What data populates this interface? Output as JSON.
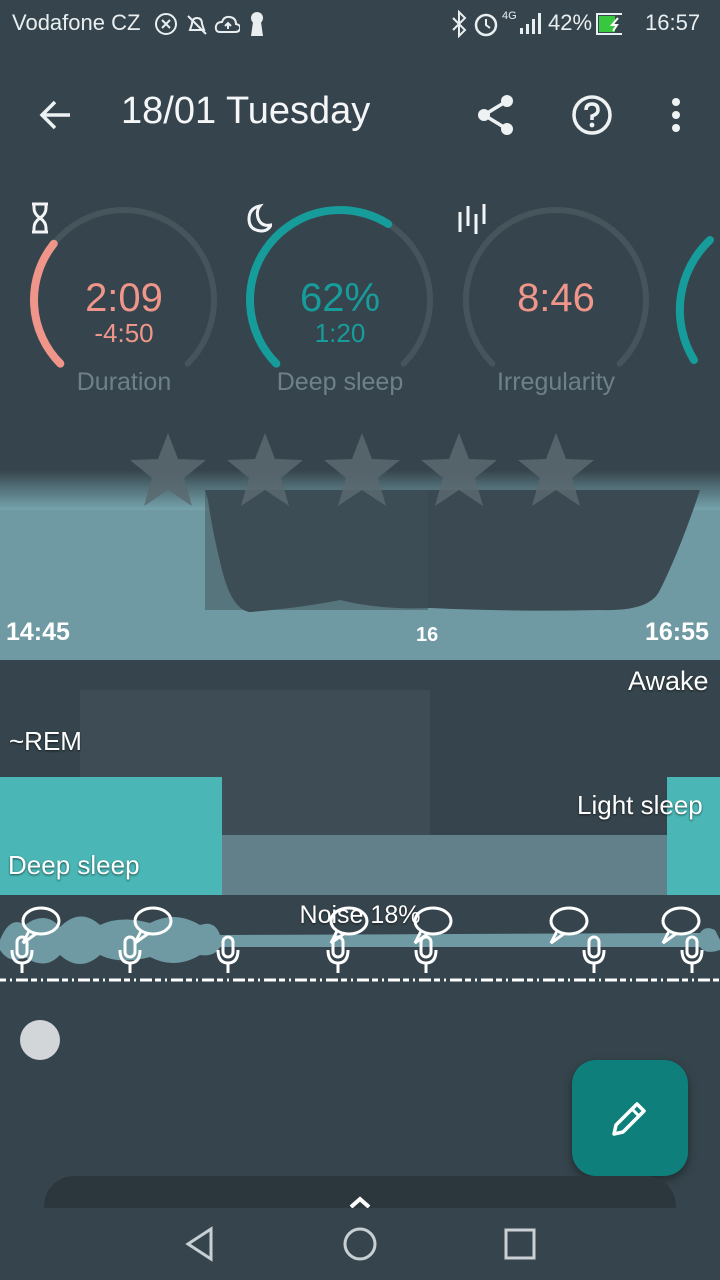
{
  "status_bar": {
    "carrier": "Vodafone CZ",
    "network": "4G",
    "battery": "42%",
    "time": "16:57",
    "icons": [
      "close-circle-icon",
      "alarm-off-icon",
      "cloud-upload-icon",
      "keyhole-icon",
      "bluetooth-icon",
      "alarm-icon",
      "signal-icon",
      "battery-charging-icon"
    ]
  },
  "app_bar": {
    "title": "18/01 Tuesday",
    "back_icon": "arrow-back-icon",
    "share_icon": "share-icon",
    "help_icon": "help-icon",
    "menu_icon": "more-vert-icon"
  },
  "gauges": [
    {
      "icon": "hourglass-icon",
      "value": "2:09",
      "sub": "-4:50",
      "label": "Duration",
      "color": "#f0958a",
      "fill": 0.31
    },
    {
      "icon": "moon-icon",
      "value": "62%",
      "sub": "1:20",
      "label": "Deep sleep",
      "color": "#169c9a",
      "fill": 0.62
    },
    {
      "icon": "irregularity-icon",
      "value": "8:46",
      "sub": "",
      "label": "Irregularity",
      "color": "#f0958a",
      "fill": 0.0
    }
  ],
  "rating": {
    "stars": 5,
    "filled": 0
  },
  "graph": {
    "start_time": "14:45",
    "mid_tick": "16",
    "end_time": "16:55"
  },
  "hypnogram": {
    "labels": {
      "awake": "Awake",
      "rem": "~REM",
      "light": "Light sleep",
      "deep": "Deep sleep"
    }
  },
  "noise": {
    "label": "Noise 18%"
  },
  "nav_bar": {
    "back": "nav-back-icon",
    "home": "nav-home-icon",
    "recents": "nav-recents-icon"
  },
  "colors": {
    "background": "#36454d",
    "accent": "#169c9a",
    "coral": "#f0958a",
    "deep": "#4ab7b6"
  }
}
